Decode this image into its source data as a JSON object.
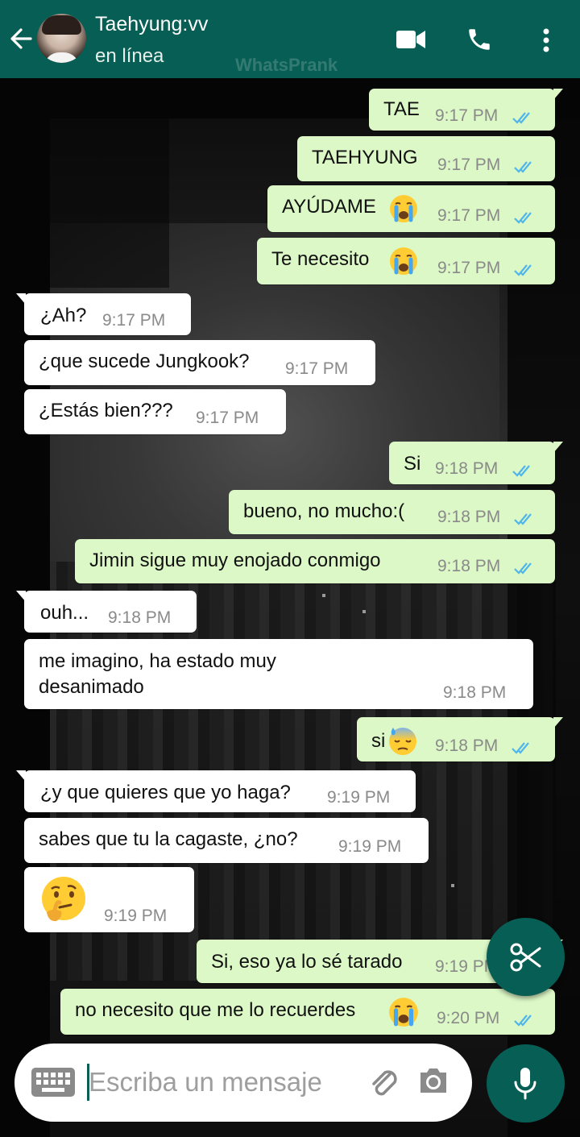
{
  "header": {
    "contact_name": "Taehyung:vv",
    "status": "en línea",
    "watermark": "WhatsPrank"
  },
  "messages": [
    {
      "dir": "out",
      "text": "TAE",
      "time": "9:17 PM",
      "ticks": "read"
    },
    {
      "dir": "out",
      "text": "TAEHYUNG",
      "time": "9:17 PM",
      "ticks": "read"
    },
    {
      "dir": "out",
      "text": "AYÚDAME",
      "emoji": "crying-face",
      "time": "9:17 PM",
      "ticks": "read"
    },
    {
      "dir": "out",
      "text": "Te necesito",
      "emoji": "crying-face",
      "time": "9:17 PM",
      "ticks": "read"
    },
    {
      "dir": "in",
      "text": "¿Ah?",
      "time": "9:17 PM"
    },
    {
      "dir": "in",
      "text": "¿que sucede Jungkook?",
      "time": "9:17 PM"
    },
    {
      "dir": "in",
      "text": "¿Estás bien???",
      "time": "9:17 PM"
    },
    {
      "dir": "out",
      "text": "Si",
      "time": "9:18 PM",
      "ticks": "read"
    },
    {
      "dir": "out",
      "text": "bueno, no mucho:(",
      "time": "9:18 PM",
      "ticks": "read"
    },
    {
      "dir": "out",
      "text": "Jimin sigue muy enojado conmigo",
      "time": "9:18 PM",
      "ticks": "read"
    },
    {
      "dir": "in",
      "text": "ouh...",
      "time": "9:18 PM"
    },
    {
      "dir": "in",
      "text": "me imagino, ha estado muy",
      "text2": "desanimado",
      "time": "9:18 PM"
    },
    {
      "dir": "out",
      "text": "si",
      "emoji": "sweat-face",
      "time": "9:18 PM",
      "ticks": "read"
    },
    {
      "dir": "in",
      "text": "¿y que quieres que yo haga?",
      "time": "9:19 PM"
    },
    {
      "dir": "in",
      "text": "sabes que tu la cagaste, ¿no?",
      "time": "9:19 PM"
    },
    {
      "dir": "in",
      "text": "",
      "emoji": "thinking-face",
      "time": "9:19 PM"
    },
    {
      "dir": "out",
      "text": "Si, eso ya lo sé tarado",
      "time": "9:19 PM",
      "ticks": "read"
    },
    {
      "dir": "out",
      "text": "no necesito que me lo recuerdes",
      "emoji": "crying-face",
      "time": "9:20 PM",
      "ticks": "read"
    }
  ],
  "input": {
    "placeholder": "Escriba un mensaje"
  },
  "colors": {
    "header": "#075e54",
    "outgoing": "#dcf8c6",
    "incoming": "#ffffff",
    "ticks": "#4fb6ec"
  }
}
